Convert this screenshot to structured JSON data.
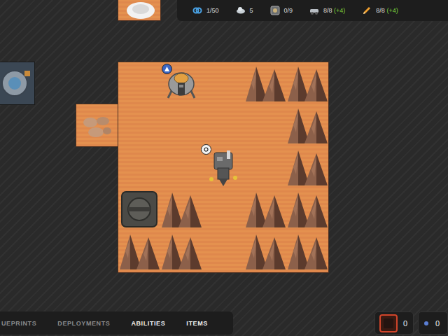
{
  "resources": [
    {
      "kind": "link",
      "value": "1/50",
      "bonus": ""
    },
    {
      "kind": "cloud",
      "value": "5",
      "bonus": ""
    },
    {
      "kind": "crate",
      "value": "0/9",
      "bonus": ""
    },
    {
      "kind": "rover",
      "value": "8/8",
      "bonus": "(+4)"
    },
    {
      "kind": "pencil",
      "value": "8/8",
      "bonus": "(+4)"
    }
  ],
  "board": {
    "cells": [
      {
        "kind": "empty",
        "badge": false
      },
      {
        "kind": "lander",
        "badge": true
      },
      {
        "kind": "empty",
        "badge": false
      },
      {
        "kind": "rocks",
        "badge": false
      },
      {
        "kind": "rocks",
        "badge": false
      },
      {
        "kind": "empty",
        "badge": false
      },
      {
        "kind": "empty",
        "badge": false
      },
      {
        "kind": "empty",
        "badge": false
      },
      {
        "kind": "empty",
        "badge": false
      },
      {
        "kind": "rocks",
        "badge": false
      },
      {
        "kind": "empty",
        "badge": false
      },
      {
        "kind": "empty",
        "badge": false
      },
      {
        "kind": "drill",
        "badge": true
      },
      {
        "kind": "empty",
        "badge": false
      },
      {
        "kind": "rocks",
        "badge": false
      },
      {
        "kind": "pad",
        "badge": false
      },
      {
        "kind": "rocks",
        "badge": false
      },
      {
        "kind": "empty",
        "badge": false
      },
      {
        "kind": "rocks",
        "badge": false
      },
      {
        "kind": "rocks",
        "badge": false
      },
      {
        "kind": "rocks",
        "badge": false
      },
      {
        "kind": "rocks",
        "badge": false
      },
      {
        "kind": "empty",
        "badge": false
      },
      {
        "kind": "rocks",
        "badge": false
      },
      {
        "kind": "rocks",
        "badge": false
      }
    ],
    "extension": {
      "kind": "rubble"
    },
    "neighbors": [
      {
        "kind": "crater"
      },
      {
        "kind": "machine"
      }
    ]
  },
  "tabs": [
    {
      "label": "UEPRINTS",
      "active": false
    },
    {
      "label": "DEPLOYMENTS",
      "active": false
    },
    {
      "label": "ABILITIES",
      "active": true
    },
    {
      "label": "ITEMS",
      "active": true
    }
  ],
  "counters": [
    {
      "kind": "core",
      "value": "0"
    },
    {
      "kind": "orb",
      "value": "0"
    }
  ]
}
